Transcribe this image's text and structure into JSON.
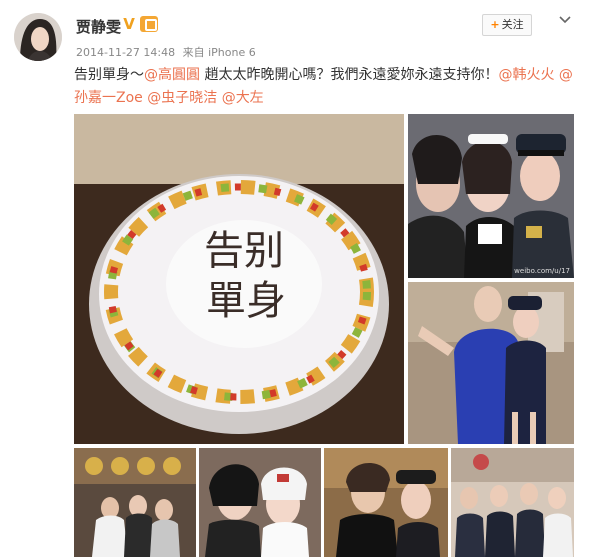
{
  "user": {
    "name": "贾静雯",
    "verified_mark": "V",
    "time": "2014-11-27 14:48",
    "source": "来自 iPhone 6"
  },
  "actions": {
    "follow_label": "关注",
    "follow_plus": "+"
  },
  "post": {
    "text_1": "告别單身～",
    "mention_1": "@高圓圓",
    "text_2": " 趙太太昨晚開心嗎？我們永遠愛妳永遠支持你！",
    "mention_2": "@韩火火",
    "mention_3": "@孙嘉一Zoe",
    "mention_4": "@虫子晓洁",
    "mention_5": "@大左"
  },
  "cake": {
    "line1": "告别",
    "line2": "單身"
  },
  "watermark": "weibo.com/u/17",
  "colors": {
    "mention": "#eb7350",
    "follow_plus": "#ff8200",
    "badge": "#f0a11f"
  },
  "icons": [
    "verified-v-icon",
    "member-icon",
    "chevron-down-icon"
  ]
}
